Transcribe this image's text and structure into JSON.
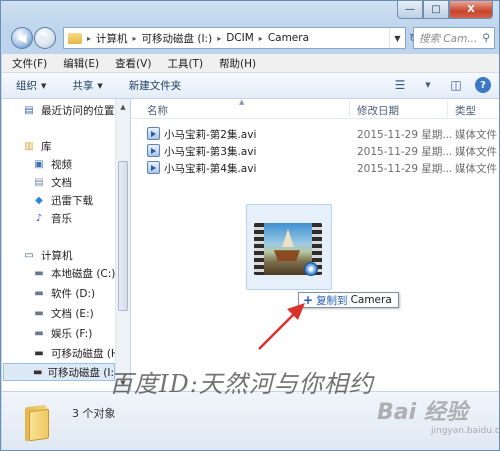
{
  "window": {
    "caption_buttons": {
      "minimize": "—",
      "maximize": "□",
      "close": "X"
    }
  },
  "address_bar": {
    "segments": [
      "计算机",
      "可移动磁盘 (I:)",
      "DCIM",
      "Camera"
    ],
    "separator": "▸"
  },
  "search": {
    "placeholder": "搜索 Cam..."
  },
  "menu": [
    "文件(F)",
    "编辑(E)",
    "查看(V)",
    "工具(T)",
    "帮助(H)"
  ],
  "toolbar": {
    "organize": "组织",
    "share": "共享",
    "new_folder": "新建文件夹"
  },
  "navigation": {
    "items": [
      {
        "label": "最近访问的位置",
        "icon": "recent-places-icon"
      },
      {
        "label": "库",
        "icon": "library-icon"
      },
      {
        "label": "视频",
        "icon": "video-library-icon"
      },
      {
        "label": "文档",
        "icon": "document-library-icon"
      },
      {
        "label": "迅雷下载",
        "icon": "thunder-download-icon"
      },
      {
        "label": "音乐",
        "icon": "music-library-icon"
      },
      {
        "label": "计算机",
        "icon": "computer-icon"
      },
      {
        "label": "本地磁盘 (C:)",
        "icon": "system-drive-icon"
      },
      {
        "label": "软件 (D:)",
        "icon": "drive-icon"
      },
      {
        "label": "文档 (E:)",
        "icon": "drive-icon"
      },
      {
        "label": "娱乐 (F:)",
        "icon": "drive-icon"
      },
      {
        "label": "可移动磁盘 (H:)",
        "icon": "removable-drive-icon"
      },
      {
        "label": "可移动磁盘 (I:)",
        "icon": "removable-drive-icon"
      }
    ]
  },
  "columns": {
    "name": "名称",
    "date": "修改日期",
    "type": "类型"
  },
  "files": [
    {
      "name": "小马宝莉-第2集.avi",
      "date": "2015-11-29 星期...",
      "type": "媒体文件"
    },
    {
      "name": "小马宝莉-第3集.avi",
      "date": "2015-11-29 星期...",
      "type": "媒体文件"
    },
    {
      "name": "小马宝莉-第4集.avi",
      "date": "2015-11-29 星期...",
      "type": "媒体文件"
    }
  ],
  "drag_tooltip": {
    "plus": "+",
    "verb": "复制到",
    "destination": "Camera"
  },
  "status": {
    "count": "3 个对象"
  },
  "watermark": {
    "text": "百度ID:天然河与你相约",
    "logo": "Bai 经验",
    "site": "jingyan.baidu.com"
  },
  "colors": {
    "accent": "#2860b3",
    "arrow": "#d9322a",
    "selection": "#dde9f7"
  }
}
